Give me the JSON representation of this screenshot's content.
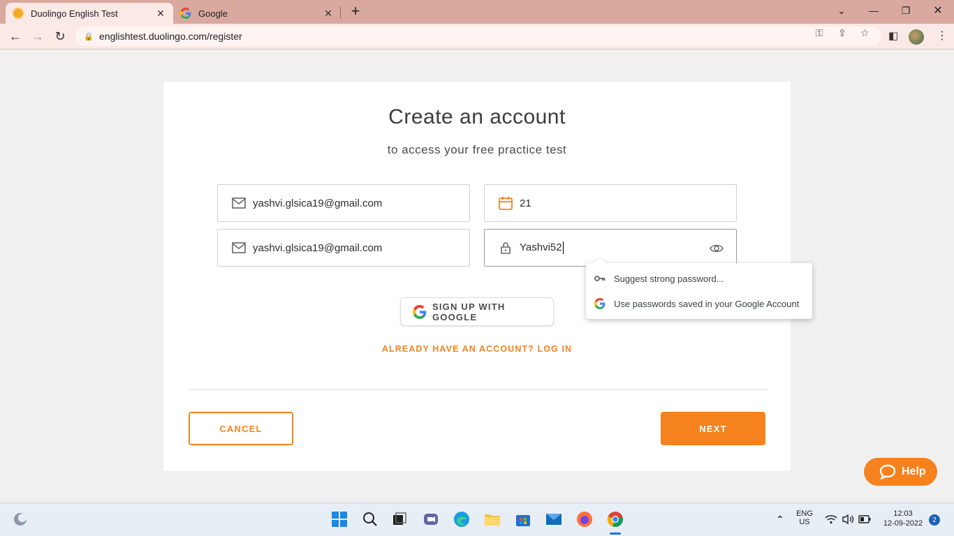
{
  "browser": {
    "tabs": [
      {
        "title": "Duolingo English Test",
        "active": true
      },
      {
        "title": "Google",
        "active": false
      }
    ],
    "url": "englishtest.duolingo.com/register"
  },
  "form": {
    "title": "Create an account",
    "subtitle": "to access your free practice test",
    "email": "yashvi.glsica19@gmail.com",
    "confirm_email": "yashvi.glsica19@gmail.com",
    "age": "21",
    "password": "Yashvi52",
    "google_signup_label": "SIGN UP WITH GOOGLE",
    "login_link": "ALREADY HAVE AN ACCOUNT? LOG IN",
    "cancel_label": "CANCEL",
    "next_label": "NEXT"
  },
  "password_popup": {
    "items": [
      {
        "label": "Suggest strong password...",
        "icon": "key-icon"
      },
      {
        "label": "Use passwords saved in your Google Account",
        "icon": "google-g-icon"
      }
    ]
  },
  "help": {
    "label": "Help"
  },
  "taskbar": {
    "lang_line1": "ENG",
    "lang_line2": "US",
    "time": "12:03",
    "date": "12-09-2022",
    "notification_count": "2"
  },
  "colors": {
    "accent": "#f5821f",
    "tab_strip": "#d9a9a0",
    "toolbar": "#fbe9e6"
  }
}
